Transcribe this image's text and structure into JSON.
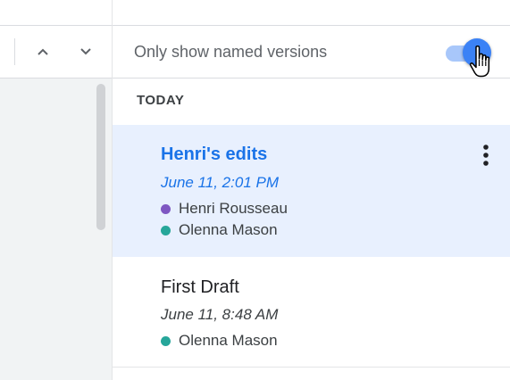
{
  "filter": {
    "label": "Only show named versions",
    "toggle_on": true,
    "toggle_colors": {
      "track": "#a8c7fa",
      "knob": "#3b82f6"
    }
  },
  "navigation": {
    "up_icon": "chevron-up-icon",
    "down_icon": "chevron-down-icon"
  },
  "section": {
    "header": "TODAY"
  },
  "versions": [
    {
      "title": "Henri's edits",
      "date": "June 11, 2:01 PM",
      "selected": true,
      "authors": [
        {
          "name": "Henri Rousseau",
          "color": "#7e57c2"
        },
        {
          "name": "Olenna Mason",
          "color": "#26a69a"
        }
      ],
      "menu_icon": "more-vert-icon"
    },
    {
      "title": "First Draft",
      "date": "June 11, 8:48 AM",
      "selected": false,
      "authors": [
        {
          "name": "Olenna Mason",
          "color": "#26a69a"
        }
      ]
    }
  ],
  "colors": {
    "accent": "#1a73e8",
    "selected_bg": "#e8f0fe"
  }
}
